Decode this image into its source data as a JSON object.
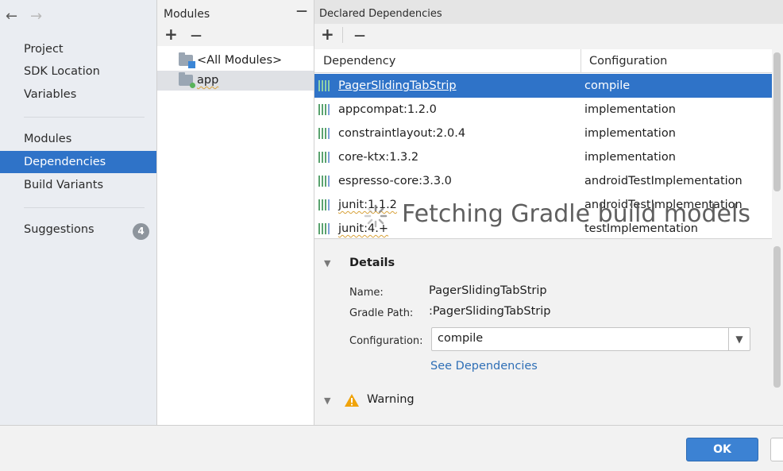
{
  "nav": {
    "back": "←",
    "forward": "→",
    "items": [
      {
        "label": "Project"
      },
      {
        "label": "SDK Location"
      },
      {
        "label": "Variables"
      },
      {
        "label": "Modules"
      },
      {
        "label": "Dependencies"
      },
      {
        "label": "Build Variants"
      }
    ],
    "suggestions": {
      "label": "Suggestions",
      "count": "4"
    }
  },
  "modules": {
    "title": "Modules",
    "collapse": "—",
    "add": "+",
    "remove": "—",
    "items": [
      {
        "label": "<All Modules>"
      },
      {
        "label": "app"
      }
    ]
  },
  "deps": {
    "title": "Declared Dependencies",
    "add": "+",
    "remove": "—",
    "columns": {
      "dependency": "Dependency",
      "configuration": "Configuration"
    },
    "rows": [
      {
        "dependency": "PagerSlidingTabStrip",
        "configuration": "compile"
      },
      {
        "dependency": "appcompat:1.2.0",
        "configuration": "implementation"
      },
      {
        "dependency": "constraintlayout:2.0.4",
        "configuration": "implementation"
      },
      {
        "dependency": "core-ktx:1.3.2",
        "configuration": "implementation"
      },
      {
        "dependency": "espresso-core:3.3.0",
        "configuration": "androidTestImplementation"
      },
      {
        "dependency": "junit:1.1.2",
        "configuration": "androidTestImplementation"
      },
      {
        "dependency": "junit:4.+",
        "configuration": "testImplementation"
      }
    ],
    "loading": "Fetching Gradle build models"
  },
  "details": {
    "title": "Details",
    "name_label": "Name:",
    "name_value": "PagerSlidingTabStrip",
    "path_label": "Gradle Path:",
    "path_value": ":PagerSlidingTabStrip",
    "config_label": "Configuration:",
    "config_value": "compile",
    "see_link": "See Dependencies",
    "warning": "Warning"
  },
  "footer": {
    "ok": "OK"
  },
  "colors": {
    "accent": "#2f73c8",
    "link": "#2f6fb6",
    "ok": "#3c82d3"
  }
}
